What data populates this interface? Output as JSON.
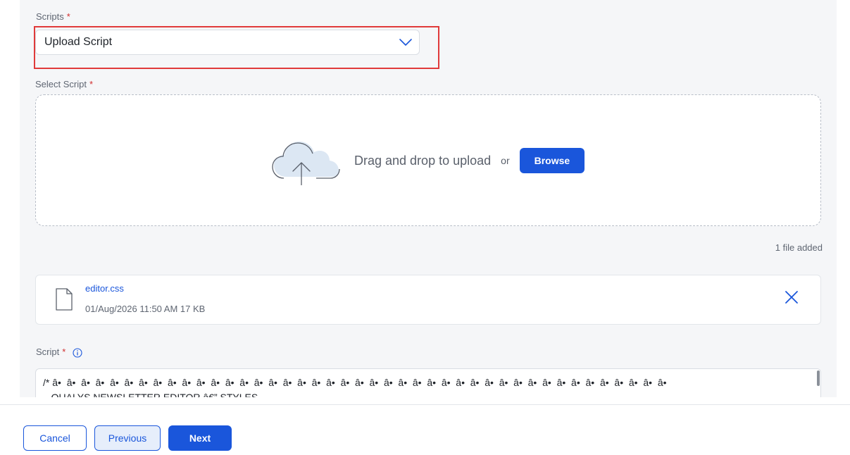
{
  "form": {
    "scripts_label": "Scripts",
    "required_mark": "*",
    "scripts_value": "Upload Script",
    "select_script_label": "Select Script",
    "script_label": "Script"
  },
  "dropzone": {
    "text": "Drag and drop to upload",
    "or": "or",
    "browse_label": "Browse"
  },
  "files": {
    "count_text": "1 file added",
    "items": [
      {
        "name": "editor.css",
        "meta": "01/Aug/2026 11:50 AM 17 KB"
      }
    ]
  },
  "script": {
    "line1": "/* â•  â•  â•  â•  â•  â•  â•  â•  â•  â•  â•  â•  â•  â•  â•  â•  â•  â•  â•  â•  â•  â•  â•  â•  â•  â•  â•  â•  â•  â•  â•  â•  â•  â•  â•  â•  â•  â•  â•  â•  â•  â•  â•",
    "line2": "   QUALYS NEWSLETTER EDITOR â€” STYLES"
  },
  "footer": {
    "cancel_label": "Cancel",
    "previous_label": "Previous",
    "next_label": "Next"
  },
  "colors": {
    "accent": "#1a56db",
    "highlight": "#e03a3a",
    "required": "#d12e2e"
  },
  "icons": {
    "dropdown": "chevron-down-icon",
    "upload": "cloud-upload-icon",
    "file": "file-icon",
    "remove": "close-icon",
    "info": "info-icon"
  }
}
